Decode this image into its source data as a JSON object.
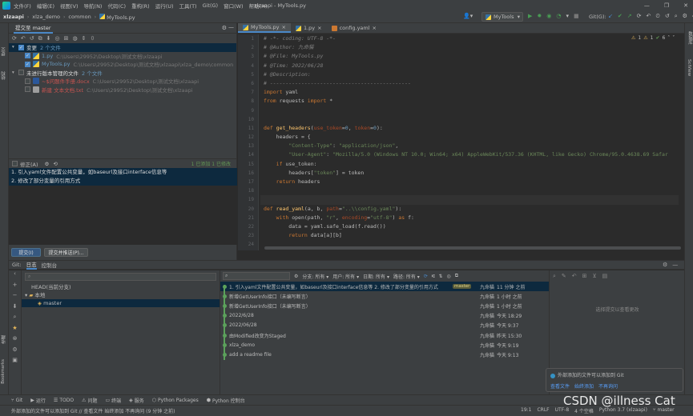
{
  "title_bar": {
    "menu": [
      "文件(F)",
      "编辑(E)",
      "视图(V)",
      "导航(N)",
      "代码(C)",
      "重构(R)",
      "运行(U)",
      "工具(T)",
      "Git(G)",
      "窗口(W)",
      "帮助(H)"
    ],
    "window_title": "xlzaapi - MyTools.py",
    "minimize": "—",
    "maximize": "❐",
    "close": "✕"
  },
  "nav": {
    "crumbs": [
      "xlzaapi",
      "xlza_demo",
      "common",
      "MyTools.py"
    ],
    "run_config": "MyTools",
    "git_label": "Git(G):"
  },
  "left_stripe": {
    "labels": [
      "提交",
      "结构"
    ],
    "bottom_labels": [
      "收藏",
      "Bookmarks"
    ]
  },
  "right_stripe": {
    "labels": [
      "数据库",
      "SciView"
    ]
  },
  "commit_panel": {
    "tab": "提交至 master",
    "tree": [
      {
        "label": "变更",
        "count": "2 个文件",
        "kind": "group",
        "checked": true
      },
      {
        "label": "1.py",
        "path": "C:\\Users\\29952\\Desktop\\测试文档\\xlzaapi",
        "kind": "file",
        "color": "blue",
        "checked": true
      },
      {
        "label": "MyTools.py",
        "path": "C:\\Users\\29952\\Desktop\\测试文档\\xlzaapi\\xlza_demo\\common",
        "kind": "file",
        "color": "blue",
        "checked": true
      },
      {
        "label": "未进行版本管理的文件",
        "count": "2 个文件",
        "kind": "group",
        "checked": false
      },
      {
        "label": "~$问题件手册.docx",
        "path": "C:\\Users\\29952\\Desktop\\测试文档\\xlzaapi",
        "kind": "file",
        "color": "red",
        "checked": false
      },
      {
        "label": "新建 文本文档.txt",
        "path": "C:\\Users\\29952\\Desktop\\测试文档\\xlzaapi",
        "kind": "file",
        "color": "red",
        "checked": false
      }
    ],
    "amend_label": "修正(A)",
    "stats": "1 已添加  1 已修改",
    "message_lines": [
      "1. 引入yaml文件配置公共变量，如baseurl及接口interface信息等",
      "2. 修改了部分变量的引用方式"
    ],
    "commit_button": "提交(I)",
    "commit_push_button": "提交并推送(P)..."
  },
  "editor": {
    "tabs": [
      {
        "label": "MyTools.py",
        "icon": "python-file-icon",
        "active": true
      },
      {
        "label": "1.py",
        "icon": "python-file-icon",
        "active": false
      },
      {
        "label": "config.yaml",
        "icon": "yaml-file-icon",
        "active": false
      }
    ],
    "inspection": {
      "warnings": "1",
      "weak": "1",
      "typos": "6"
    },
    "line_numbers": [
      "1",
      "2",
      "3",
      "4",
      "5",
      "6",
      "7",
      "8",
      "9",
      "10",
      "11",
      "12",
      "13",
      "14",
      "15",
      "16",
      "17",
      "18",
      "19",
      "20",
      "21",
      "22",
      "23",
      "24"
    ],
    "code": [
      "# -*- coding: UTF-8 -*-",
      "# @Author: 九命猫",
      "# @File: MyTools.py",
      "# @Time: 2022/06/28",
      "# @Description:",
      "# ---------------------------------------------",
      "import yaml",
      "from requests import *",
      "",
      "",
      "def get_headers(use_token=0, token=0):",
      "    headers = {",
      "        \"Content-Type\": \"application/json\",",
      "        \"User-Agent\": \"Mozilla/5.0 (Windows NT 10.0; Win64; x64) AppleWebKit/537.36 (KHTML, like Gecko) Chrome/95.0.4638.69 Safar",
      "    if use_token:",
      "        headers[\"token\"] = token",
      "    return headers",
      "",
      "",
      "def read_yaml(a, b, path=\"..\\\\config.yaml\"):",
      "    with open(path, \"r\", encoding=\"utf-8\") as f:",
      "        data = yaml.safe_load(f.read())",
      "        return data[a][b]",
      ""
    ]
  },
  "git_panel": {
    "label": "Git:",
    "tabs": [
      "日志",
      "控制台"
    ],
    "branches": {
      "search_placeholder": "",
      "head": "HEAD(当前分支)",
      "local": "本地",
      "current": "master"
    },
    "filters": [
      "分支: 所有",
      "用户: 所有",
      "日期: 所有",
      "路径: 所有"
    ],
    "commits": [
      {
        "msg": "1. 引入yaml文件配置公共变量，如baseurl及接口interface信息等 2. 修改了部分变量的引用方式",
        "tag": "master",
        "author": "九命猫",
        "time": "11 分钟 之前"
      },
      {
        "msg": "新增GetUserInfo接口（未编写断言）",
        "tag": "",
        "author": "九命猫",
        "time": "1 小时 之前"
      },
      {
        "msg": "新增GetUserInfo接口（未编写断言）",
        "tag": "",
        "author": "九命猫",
        "time": "1 小时 之前"
      },
      {
        "msg": "2022/6/28",
        "tag": "",
        "author": "九命猫",
        "time": "今天 18:29"
      },
      {
        "msg": "2022/06/28",
        "tag": "",
        "author": "九命猫",
        "time": "今天 9:37"
      },
      {
        "msg": "由Modified改变为Staged",
        "tag": "",
        "author": "九命猫",
        "time": "昨天 15:30"
      },
      {
        "msg": "xlza_demo",
        "tag": "",
        "author": "九命猫",
        "time": "今天 9:19"
      },
      {
        "msg": "add a readme file",
        "tag": "",
        "author": "九命猫",
        "time": "今天 9:13"
      }
    ],
    "details_empty": "选择提交以查看更改",
    "notification": {
      "text": "外部添加的文件可以添加到 Git",
      "links": [
        "查看文件",
        "始终添加",
        "不再询问"
      ]
    }
  },
  "tool_windows": [
    "Git",
    "运行",
    "TODO",
    "问题",
    "终端",
    "服务",
    "Python Packages",
    "Python 控制台"
  ],
  "status_bar": {
    "message": "外部添加的文件可以添加到 Git // 查看文件  始终添加  不再询问 (9 分钟 之前)",
    "position": "19:1",
    "line_sep": "CRLF",
    "encoding": "UTF-8",
    "indent": "4 个空格",
    "interpreter": "Python 3.7 (xlzaapi)",
    "branch": "master"
  },
  "watermark": "CSDN @illness  Cat"
}
